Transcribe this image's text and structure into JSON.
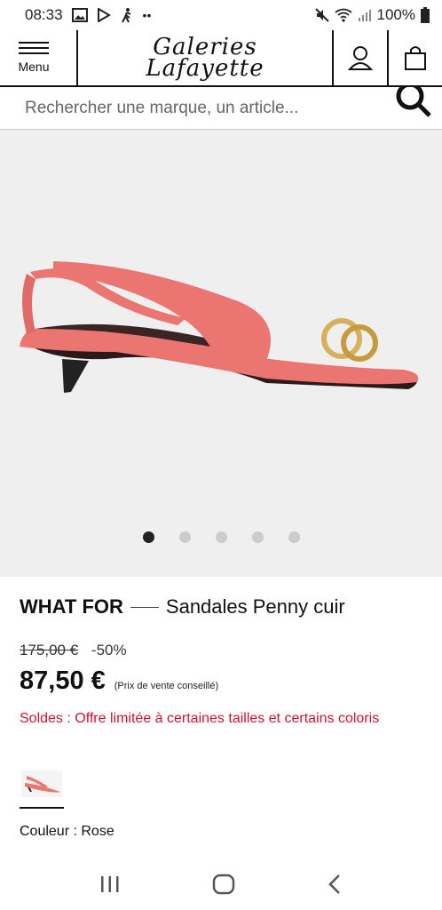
{
  "status_bar": {
    "time": "08:33",
    "battery": "100%"
  },
  "header": {
    "menu_label": "Menu",
    "logo_line1": "Galeries",
    "logo_line2": "Lafayette"
  },
  "search": {
    "placeholder": "Rechercher une marque, un article..."
  },
  "gallery": {
    "dot_count": 5,
    "active_index": 0,
    "shoe_color": "#ea7571"
  },
  "product": {
    "brand": "WHAT FOR",
    "name": "Sandales Penny cuir",
    "old_price": "175,00 €",
    "discount": "-50%",
    "price": "87,50 €",
    "price_note": "(Prix de vente conseillé)",
    "sale_text": "Soldes : Offre limitée à certaines tailles et certains coloris",
    "color_label": "Couleur : Rose"
  },
  "colors": {
    "sale_red": "#c81432",
    "gallery_bg": "#efefef"
  }
}
